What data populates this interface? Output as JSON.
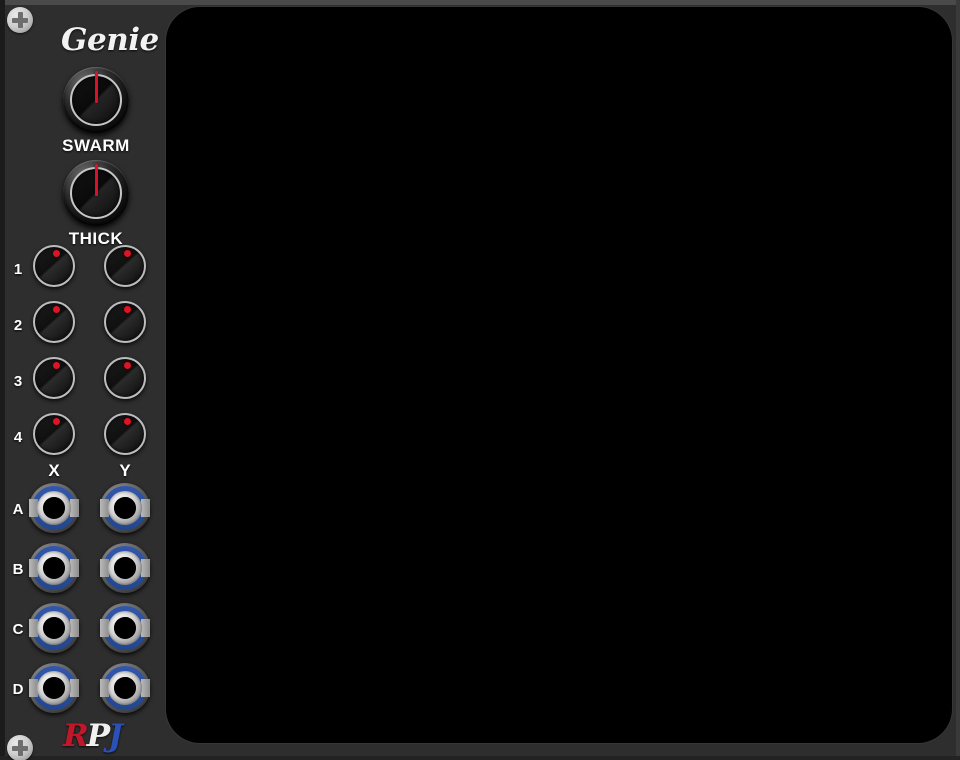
{
  "module": {
    "brand": "Genie",
    "signature": {
      "r": "R",
      "p": "P",
      "j": "J"
    },
    "panel_color": "#2e2e2e",
    "accent_red": "#d9112a",
    "accent_blue": "#2a4f9e"
  },
  "screws": [
    {
      "name": "screw-top-left"
    },
    {
      "name": "screw-bottom-left"
    }
  ],
  "big_knobs": [
    {
      "label": "SWARM",
      "value_angle": 0
    },
    {
      "label": "THICK",
      "value_angle": 0
    }
  ],
  "knob_matrix": {
    "column_headers": [
      "X",
      "Y"
    ],
    "row_labels": [
      "1",
      "2",
      "3",
      "4"
    ],
    "rows": [
      {
        "label": "1",
        "x": {
          "value_angle": 10
        },
        "y": {
          "value_angle": 10
        }
      },
      {
        "label": "2",
        "x": {
          "value_angle": 10
        },
        "y": {
          "value_angle": 10
        }
      },
      {
        "label": "3",
        "x": {
          "value_angle": 10
        },
        "y": {
          "value_angle": 10
        }
      },
      {
        "label": "4",
        "x": {
          "value_angle": 10
        },
        "y": {
          "value_angle": 10
        }
      }
    ]
  },
  "jack_matrix": {
    "row_labels": [
      "A",
      "B",
      "C",
      "D"
    ],
    "columns": [
      "X",
      "Y"
    ]
  },
  "display": {
    "content": "",
    "background": "#000000"
  }
}
